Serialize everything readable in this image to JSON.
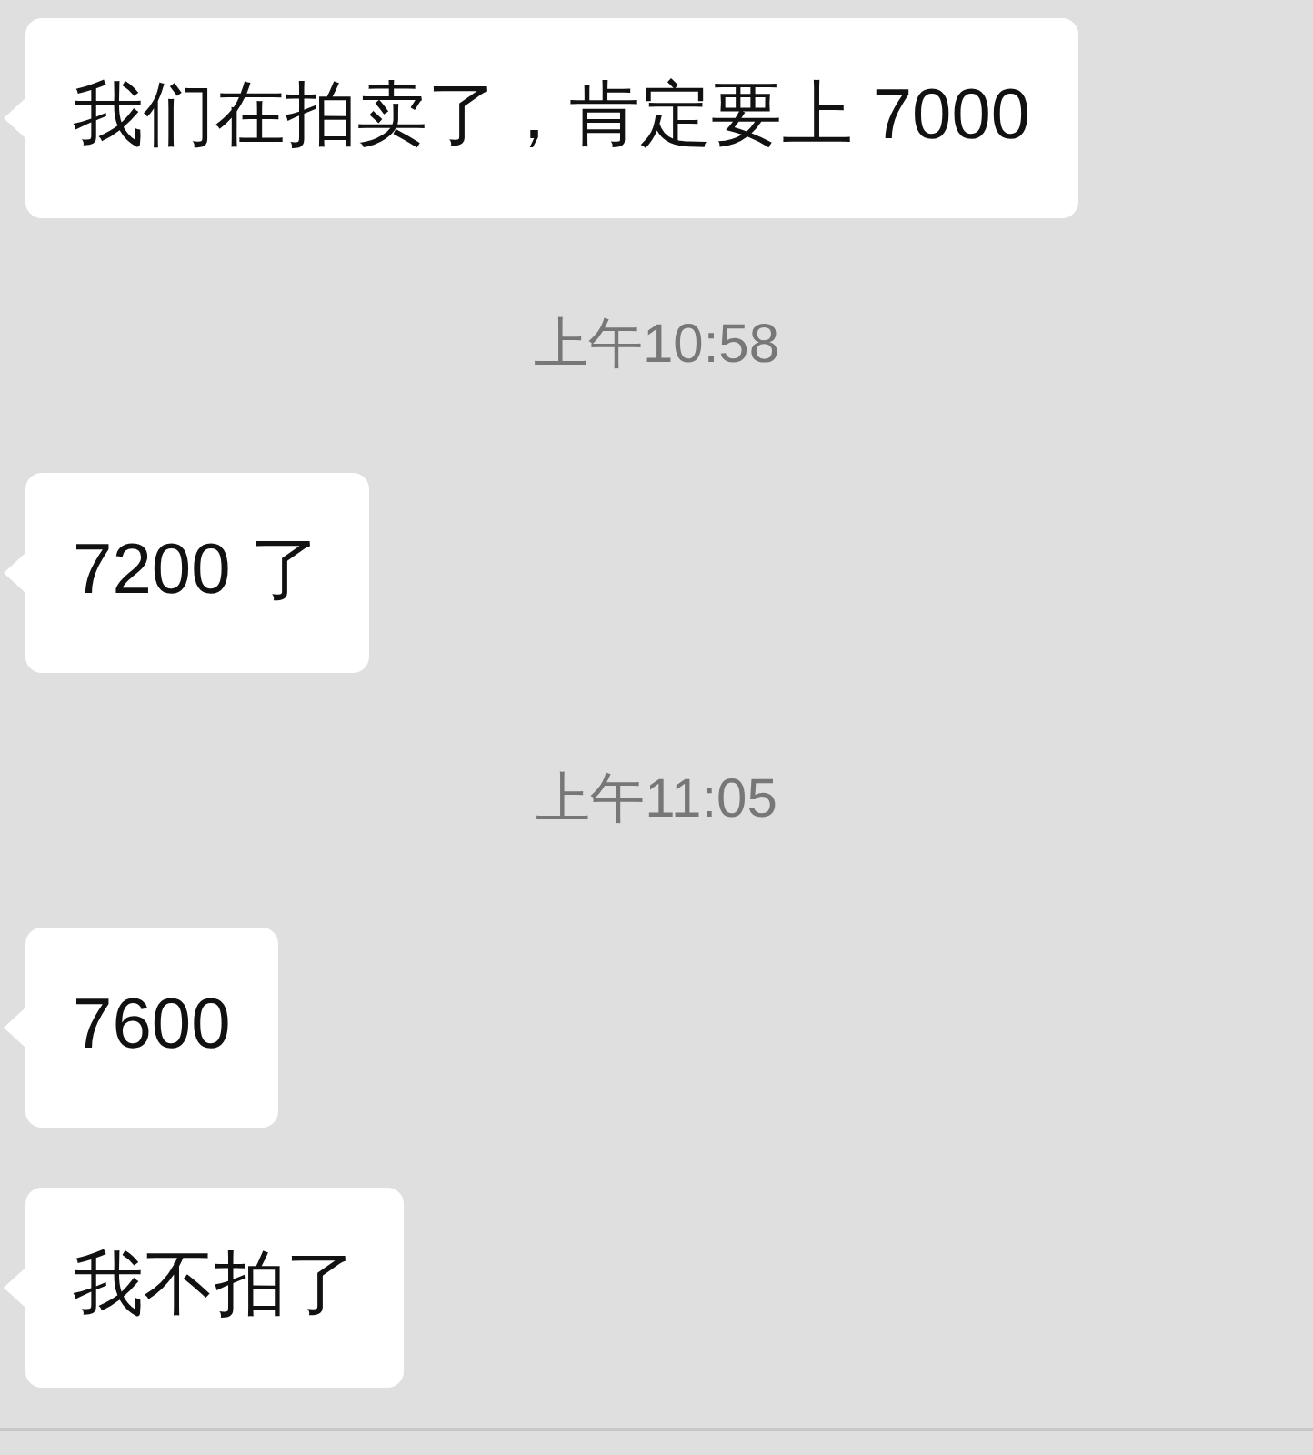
{
  "messages": [
    {
      "kind": "bubble",
      "text": "我们在拍卖了，肯定要上 7000"
    },
    {
      "kind": "time",
      "text": "上午10:58"
    },
    {
      "kind": "bubble",
      "text": "7200 了"
    },
    {
      "kind": "time",
      "text": "上午11:05"
    },
    {
      "kind": "bubble",
      "text": "7600"
    },
    {
      "kind": "bubble",
      "text": "我不拍了"
    }
  ]
}
